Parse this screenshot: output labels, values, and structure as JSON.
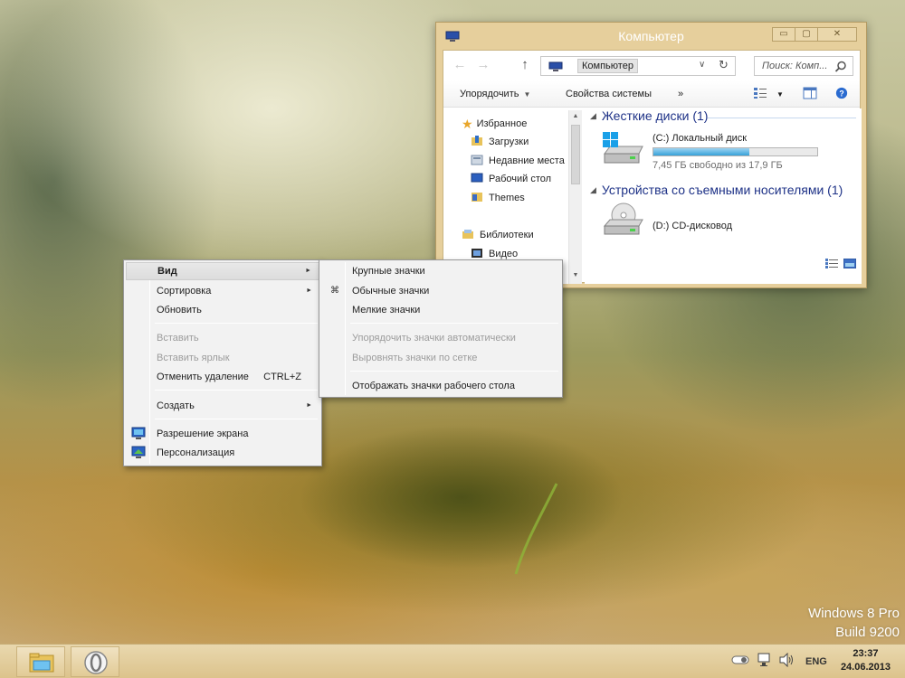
{
  "desktop": {
    "watermark": {
      "line1": "Windows 8 Pro",
      "line2": "Build 9200"
    }
  },
  "explorer": {
    "title": "Компьютер",
    "controls": {
      "minimize": "▭",
      "maximize": "▢",
      "close": "✕"
    },
    "navigation": {
      "back": "←",
      "forward": "→",
      "up": "↑",
      "address_crumb": "Компьютер",
      "search_placeholder": "Поиск: Комп..."
    },
    "commands": {
      "organize": "Упорядочить",
      "system_properties": "Свойства системы",
      "more": "»"
    },
    "nav_pane": {
      "favorites": "Избранное",
      "favorites_items": [
        "Загрузки",
        "Недавние места",
        "Рабочий стол",
        "Themes"
      ],
      "libraries": "Библиотеки",
      "libraries_items": [
        "Видео"
      ]
    },
    "groups": {
      "hard_disks": "Жесткие диски (1)",
      "removable": "Устройства со съемными носителями (1)"
    },
    "drives": {
      "c_name": "(C:) Локальный диск",
      "c_free": "7,45 ГБ свободно из 17,9 ГБ",
      "c_used_fraction": 0.584,
      "d_name": "(D:) CD-дисковод"
    }
  },
  "context_menu": {
    "items": [
      {
        "label": "Вид",
        "submenu": true
      },
      {
        "label": "Сортировка",
        "submenu": true
      },
      {
        "label": "Обновить"
      },
      {
        "label": "Вставить",
        "disabled": true
      },
      {
        "label": "Вставить ярлык",
        "disabled": true
      },
      {
        "label": "Отменить удаление",
        "shortcut": "CTRL+Z"
      },
      {
        "label": "Создать",
        "submenu": true
      },
      {
        "label": "Разрешение экрана"
      },
      {
        "label": "Персонализация"
      }
    ]
  },
  "view_submenu": {
    "items": [
      {
        "label": "Крупные значки"
      },
      {
        "label": "Обычные значки",
        "checked": true
      },
      {
        "label": "Мелкие значки"
      },
      {
        "label": "Упорядочить значки автоматически",
        "disabled": true
      },
      {
        "label": "Выровнять значки по сетке",
        "disabled": true
      },
      {
        "label": "Отображать значки рабочего стола"
      }
    ]
  },
  "taskbar": {
    "language": "ENG",
    "time": "23:37",
    "date": "24.06.2013"
  }
}
